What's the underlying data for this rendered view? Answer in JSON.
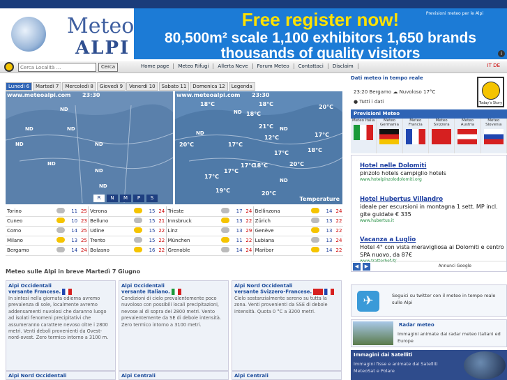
{
  "logo": {
    "line1": "Meteo",
    "line2": "ALPI"
  },
  "banner": {
    "headline": "Free register now!",
    "line2": "80,500m² scale  1,100 exhibitors  1,650 brands",
    "line3": "thousands of quality visitors",
    "corner": "Previsioni meteo per le Alpi",
    "info": "i"
  },
  "nav": {
    "search_placeholder": "Cerca Località ...",
    "search_button": "Cerca",
    "links": [
      "Home page",
      "Meteo Rifugi",
      "Allerta Neve",
      "Forum Meteo",
      "Contattaci",
      "Disclaim"
    ],
    "lang": "IT DE"
  },
  "day_tabs": [
    "Lunedì 6",
    "Martedì 7",
    "Mercoledì 8",
    "Giovedì 9",
    "Venerdì 10",
    "Sabato 11",
    "Domenica 12",
    "Legenda"
  ],
  "map_left": {
    "site": "www.meteoalpi.com",
    "time": "23:30",
    "label": "ND",
    "buttons": [
      "R",
      "N",
      "M",
      "P",
      "S"
    ]
  },
  "map_right": {
    "site": "www.meteoalpi.com",
    "time": "23:30",
    "temps": [
      "18°C",
      "18°C",
      "21°C",
      "20°C",
      "18°C",
      "17°C",
      "12°C",
      "17°C",
      "20°C",
      "17°C",
      "18°C",
      "18°C",
      "17°C",
      "20°C",
      "17°C",
      "17°C",
      "19°C",
      "20°C"
    ],
    "label": "ND",
    "footer": "Temperature"
  },
  "cities": [
    [
      [
        "Torino",
        11,
        25
      ],
      [
        "Verona",
        15,
        24
      ],
      [
        "Trieste",
        17,
        24
      ],
      [
        "Bellinzona",
        14,
        24
      ]
    ],
    [
      [
        "Cuneo",
        10,
        23
      ],
      [
        "Belluno",
        15,
        21
      ],
      [
        "Innsbruck",
        13,
        22
      ],
      [
        "Zürich",
        13,
        22
      ]
    ],
    [
      [
        "Como",
        14,
        25
      ],
      [
        "Udine",
        15,
        22
      ],
      [
        "Linz",
        13,
        29
      ],
      [
        "Genève",
        13,
        22
      ]
    ],
    [
      [
        "Milano",
        13,
        25
      ],
      [
        "Trento",
        15,
        22
      ],
      [
        "München",
        11,
        22
      ],
      [
        "Lubiana",
        13,
        24
      ]
    ],
    [
      [
        "Bergamo",
        14,
        24
      ],
      [
        "Bolzano",
        16,
        22
      ],
      [
        "Grenoble",
        14,
        24
      ],
      [
        "Maribor",
        14,
        22
      ]
    ]
  ],
  "brief_title": "Meteo sulle Alpi in breve Martedì 7 Giugno",
  "regions": [
    {
      "title": "Alpi Occidentali",
      "subtitle": "versante Francese.",
      "text": "In sintesi nella giornata odierna avremo prevalenza di sole, localmente avremo addensamenti nuvolosi che daranno luogo ad isolati fenomeni precipitativi che assumeranno carattere nevoso oltre i 2800 metri. Venti deboli provenienti da Ovest-nord-ovest. Zero termico intorno a 3100 m."
    },
    {
      "title": "Alpi Occidentali",
      "subtitle": "versante Italiano.",
      "text": "Condizioni di cielo prevalentemente poco nuvoloso con possibili locali precipitazioni, nevose al di sopra dei 2800 metri. Vento prevalentemente da SE di debole intensità. Zero termico intorno a 3100 metri."
    },
    {
      "title": "Alpi Nord Occidentali",
      "subtitle": "versante Svizzero-Francese.",
      "text": "Cielo sostanzialmente sereno su tutta la zona. Venti provenienti da SSE di debole intensità. Quota 0 °C a 3200 metri."
    }
  ],
  "regions_next": [
    "Alpi Nord Occidentali",
    "Alpi Centrali",
    "Alpi Centrali"
  ],
  "realtime": {
    "title": "Dati meteo in tempo reale",
    "city": "23:20 Bergamo",
    "cond": "Nuvoloso 17°C",
    "all": "Tutti i dati",
    "badge": "Today's Story"
  },
  "previsioni": {
    "title": "Previsioni Meteo",
    "countries": [
      "Meteo Italia",
      "Meteo Germania",
      "Meteo Francia",
      "Meteo Svizzera",
      "Meteo Austria",
      "Meteo Slovenia"
    ]
  },
  "ads": [
    {
      "title": "Hotel nelle Dolomiti",
      "text": "pinzolo hotels campiglio hotels",
      "url": "www.hotelpinzolodolomiti.org"
    },
    {
      "title": "Hotel Hubertus Villandro",
      "text": "ideale per escursioni in montagna 1 sett. MP incl. gite guidate € 335",
      "url": "www.hubertus.it"
    },
    {
      "title": "Vacanza a Luglio",
      "text": "Hotel 4° con vista meravigliosa ai Dolomiti e centro SPA nuovo, da 87€",
      "url": "www.tratterhof.it/"
    }
  ],
  "ads_footer": {
    "label": "Annunci Google",
    "google": "Google"
  },
  "twitter": {
    "text": "Seguici su twitter con il meteo in tempo reale sulle Alpi"
  },
  "radar": {
    "title": "Radar meteo",
    "text": "Immagini animate dai radar meteo italiani ed Europe"
  },
  "satellite": {
    "title": "Immagini dai Satelliti",
    "text": "Immagini fisse e animate dai Satelliti MeteoSat e Polare"
  },
  "colors": {
    "accent": "#2f64b5",
    "banner": "#1c7bd6",
    "headline": "#ffe100"
  }
}
